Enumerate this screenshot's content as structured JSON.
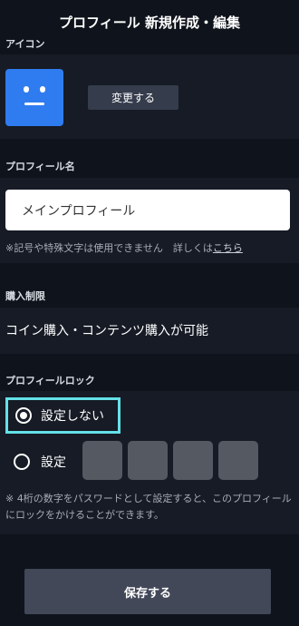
{
  "header": {
    "title": "プロフィール 新規作成・編集"
  },
  "icon_section": {
    "label": "アイコン",
    "change_button": "変更する",
    "avatar_icon": "smiley-face-icon",
    "avatar_color": "#2f7cf0"
  },
  "name_section": {
    "label": "プロフィール名",
    "value": "メインプロフィール",
    "note": "※記号や特殊文字は使用できません　詳しくは",
    "note_link": "こちら"
  },
  "purchase_section": {
    "label": "購入制限",
    "value": "コイン購入・コンテンツ購入が可能"
  },
  "lock_section": {
    "label": "プロフィールロック",
    "options": [
      {
        "label": "設定しない",
        "selected": true
      },
      {
        "label": "設定",
        "selected": false
      }
    ],
    "pin_digits": [
      "",
      "",
      "",
      ""
    ],
    "note": "※ 4桁の数字をパスワードとして設定すると、このプロフィールにロックをかけることができます。"
  },
  "footer": {
    "save_button": "保存する"
  },
  "colors": {
    "background": "#0f131b",
    "panel": "#161b25",
    "focus_ring": "#64e1e8"
  }
}
